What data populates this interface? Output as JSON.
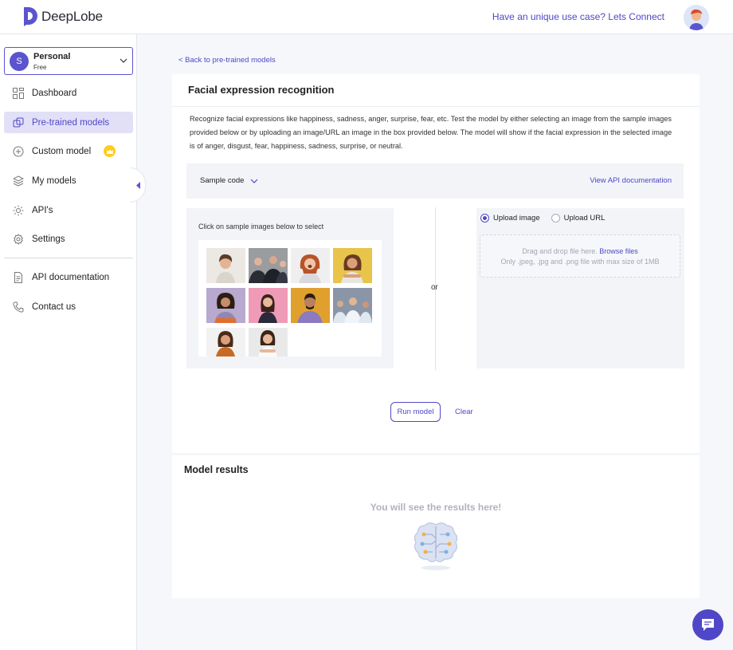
{
  "app": {
    "name": "DeepLobe",
    "brand_color": "#4f47c7"
  },
  "header": {
    "connect_link": "Have an unique use case? Lets Connect"
  },
  "account": {
    "initial": "S",
    "name": "Personal",
    "plan": "Free"
  },
  "sidebar": {
    "items": [
      {
        "label": "Dashboard",
        "icon": "dashboard-icon"
      },
      {
        "label": "Pre-trained models",
        "icon": "pretrained-icon",
        "active": true
      },
      {
        "label": "Custom model",
        "icon": "plus-circle-icon"
      },
      {
        "label": "My models",
        "icon": "layers-icon"
      },
      {
        "label": "API's",
        "icon": "api-gear-icon"
      },
      {
        "label": "Settings",
        "icon": "gear-icon"
      }
    ],
    "bottom_items": [
      {
        "label": "API documentation",
        "icon": "document-icon"
      },
      {
        "label": "Contact us",
        "icon": "phone-icon"
      }
    ]
  },
  "main": {
    "back_link": "< Back to pre-trained models",
    "title": "Facial expression recognition",
    "description": "Recognize facial expressions like happiness, sadness, anger, surprise, fear, etc. Test the model by either selecting an image from the sample images provided below or by uploading an image/URL an image in the box provided below. The model will show if the facial expression in the selected image is of anger, disgust, fear, happiness, sadness, surprise, or neutral.",
    "sample_code_label": "Sample code",
    "api_doc_link": "View API documentation",
    "sample_hint": "Click on sample images below to select",
    "or_label": "or",
    "upload": {
      "option_image": "Upload image",
      "option_url": "Upload URL",
      "selected": "Upload image",
      "drop_text": "Drag and drop file here.",
      "browse_link": "Browse files",
      "constraint_text": "Only .jpeg, .jpg and .png file with max size of 1MB"
    },
    "run_button": "Run model",
    "clear_button": "Clear"
  },
  "results": {
    "title": "Model results",
    "empty_message": "You will see the results here!"
  }
}
